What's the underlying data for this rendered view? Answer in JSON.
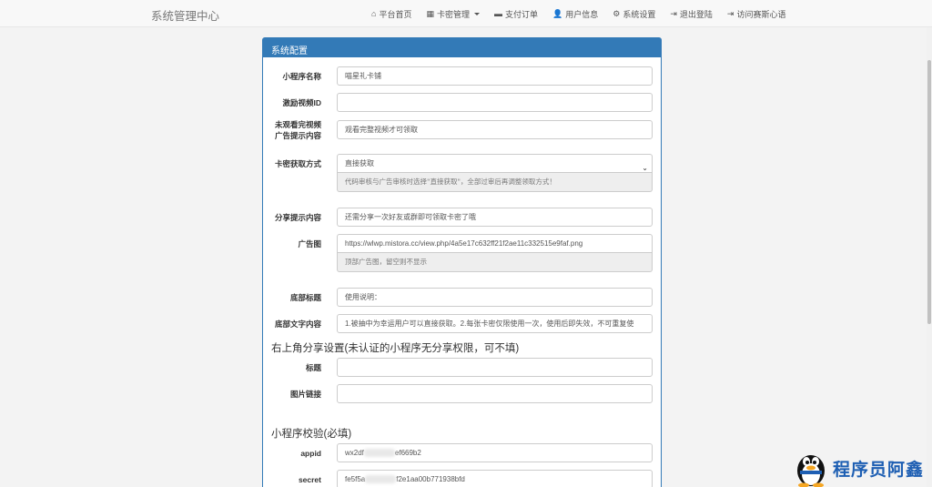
{
  "navbar": {
    "brand": "系统管理中心",
    "items": [
      {
        "icon": "home-icon",
        "glyph": "⌂",
        "label": "平台首页"
      },
      {
        "icon": "grid-icon",
        "glyph": "▦",
        "label": "卡密管理",
        "dropdown": true
      },
      {
        "icon": "card-icon",
        "glyph": "▬",
        "label": "支付订单"
      },
      {
        "icon": "user-icon",
        "glyph": "👤",
        "label": "用户信息"
      },
      {
        "icon": "gear-icon",
        "glyph": "⚙",
        "label": "系统设置"
      },
      {
        "icon": "logout-icon",
        "glyph": "⇥",
        "label": "退出登陆"
      },
      {
        "icon": "external-link-icon",
        "glyph": "⇥",
        "label": "访问赛斯心语"
      }
    ]
  },
  "panel": {
    "title": "系统配置",
    "fields": {
      "app_name": {
        "label": "小程序名称",
        "value": "喵星礼卡铺"
      },
      "video_id": {
        "label": "激励视频ID",
        "value": ""
      },
      "ad_tip": {
        "label1": "未观看完视频",
        "label2": "广告提示内容",
        "value": "观看完整视频才可领取"
      },
      "fetch_mode": {
        "label": "卡密获取方式",
        "value": "直接获取",
        "help": "代码审核与广告审核时选择\"直接获取\"，全部过审后再调整领取方式！"
      },
      "share_tip": {
        "label": "分享提示内容",
        "value": "还需分享一次好友或群即可领取卡密了哦"
      },
      "ad_image": {
        "label": "广告图",
        "value": "https://wlwp.mistora.cc/view.php/4a5e17c632ff21f2ae11c332515e9faf.png",
        "help": "顶部广告图，留空则不显示"
      },
      "footer_title": {
        "label": "底部标题",
        "value": "使用说明："
      },
      "footer_text": {
        "label": "底部文字内容",
        "value": "1.被抽中为幸运用户可以直接获取。2.每张卡密仅限使用一次，使用后即失效，不可重复使"
      }
    },
    "share_section": {
      "title": "右上角分享设置(未认证的小程序无分享权限，可不填)",
      "title_label": "标题",
      "title_value": "",
      "image_label": "图片链接",
      "image_value": ""
    },
    "verify_section": {
      "title": "小程序校验(必填)",
      "appid_label": "appid",
      "appid_prefix": "wx2df",
      "appid_suffix": "ef669b2",
      "secret_label": "secret",
      "secret_prefix": "fe5f5a",
      "secret_suffix": "f2e1aa00b771938bfd"
    }
  },
  "watermark": {
    "text": "程序员阿鑫"
  }
}
